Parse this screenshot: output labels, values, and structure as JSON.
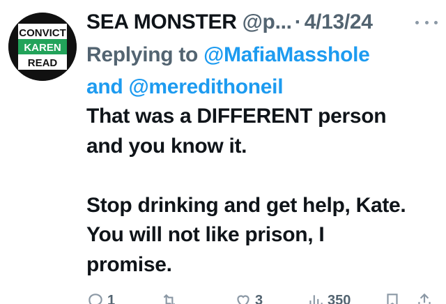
{
  "tweet": {
    "avatar": {
      "line1": "CONVICT",
      "line2": "KAREN",
      "line3": "READ",
      "bg": "#111111",
      "band": "#22a35a"
    },
    "display_name": "SEA MONSTER",
    "handle": "@p...",
    "separator": "·",
    "date": "4/13/24",
    "replying_prefix": "Replying to",
    "mention_1": "@MafiaMasshole",
    "conjunction": "and",
    "mention_2": "@meredithoneil",
    "body_lines": [
      "That was a DIFFERENT person",
      "and you know it.",
      "",
      "Stop drinking and get help, Kate.",
      "You will not like prison, I",
      "promise."
    ],
    "actions": {
      "replies": "1",
      "retweets": "",
      "likes": "3",
      "views": "350"
    },
    "colors": {
      "text": "#0f1419",
      "secondary": "#536471",
      "link": "#1d9bf0"
    }
  }
}
